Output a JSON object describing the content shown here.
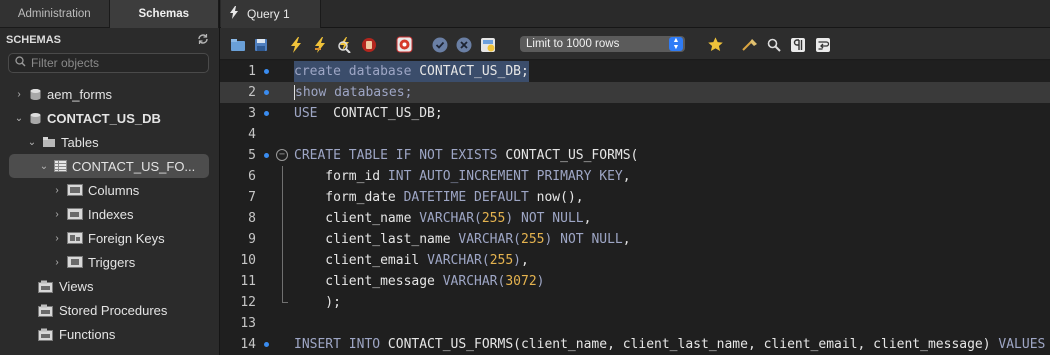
{
  "left_tabs": [
    "Administration",
    "Schemas"
  ],
  "schemas_header": "SCHEMAS",
  "filter_placeholder": "Filter objects",
  "tree": {
    "schema1": "aem_forms",
    "schema2": "CONTACT_US_DB",
    "tables": "Tables",
    "table1": "CONTACT_US_FO...",
    "columns": "Columns",
    "indexes": "Indexes",
    "foreign_keys": "Foreign Keys",
    "triggers": "Triggers",
    "views": "Views",
    "stored_procedures": "Stored Procedures",
    "functions": "Functions"
  },
  "query_tab": "Query 1",
  "limit_select": "Limit to 1000 rows",
  "line_numbers": [
    "1",
    "2",
    "3",
    "4",
    "5",
    "6",
    "7",
    "8",
    "9",
    "10",
    "11",
    "12",
    "13",
    "14"
  ],
  "colors": {
    "accent": "#3a8cf0",
    "keyword": "#9ea6c5",
    "number": "#e5b34f",
    "selection": "#3b4d6b"
  },
  "code": {
    "l1": {
      "kw1": "create database",
      "rest": " CONTACT_US_DB;"
    },
    "l2": {
      "kw1": "show databases;"
    },
    "l3": {
      "kw1": "USE",
      "rest": "  CONTACT_US_DB;"
    },
    "l5": {
      "kw1": "CREATE TABLE IF NOT EXISTS",
      "rest": " CONTACT_US_FORMS("
    },
    "l6": {
      "ind": "    form_id ",
      "kw1": "INT AUTO_INCREMENT PRIMARY KEY",
      "rest": ","
    },
    "l7": {
      "ind": "    form_date ",
      "kw1": "DATETIME DEFAULT",
      "rest": " now(),"
    },
    "l8": {
      "ind": "    client_name ",
      "kw1": "VARCHAR(",
      "n": "255",
      "kw2": ") NOT NULL",
      "rest": ","
    },
    "l9": {
      "ind": "    client_last_name ",
      "kw1": "VARCHAR(",
      "n": "255",
      "kw2": ") NOT NULL",
      "rest": ","
    },
    "l10": {
      "ind": "    client_email ",
      "kw1": "VARCHAR(",
      "n": "255",
      "kw2": ")",
      "rest": ","
    },
    "l11": {
      "ind": "    client_message ",
      "kw1": "VARCHAR(",
      "n": "3072",
      "kw2": ")"
    },
    "l12": {
      "ind": "    );"
    },
    "l14": {
      "kw1": "INSERT INTO",
      "rest": " CONTACT_US_FORMS(client_name, client_last_name, client_email, client_message) ",
      "kw2": "VALUES"
    }
  }
}
